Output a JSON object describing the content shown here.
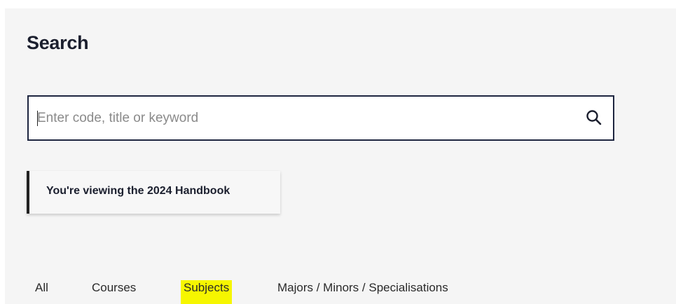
{
  "page": {
    "title": "Search"
  },
  "search": {
    "placeholder": "Enter code, title or keyword",
    "value": "",
    "button_icon": "search-icon"
  },
  "notice": {
    "text": "You're viewing the 2024 Handbook"
  },
  "tabs": [
    {
      "label": "All"
    },
    {
      "label": "Courses"
    },
    {
      "label": "Subjects",
      "highlighted": true
    },
    {
      "label": "Majors / Minors / Specialisations"
    }
  ],
  "colors": {
    "panel_background": "#f5f5f5",
    "search_border": "#1e2640",
    "highlight": "#f6f600",
    "notice_border": "#222222"
  }
}
